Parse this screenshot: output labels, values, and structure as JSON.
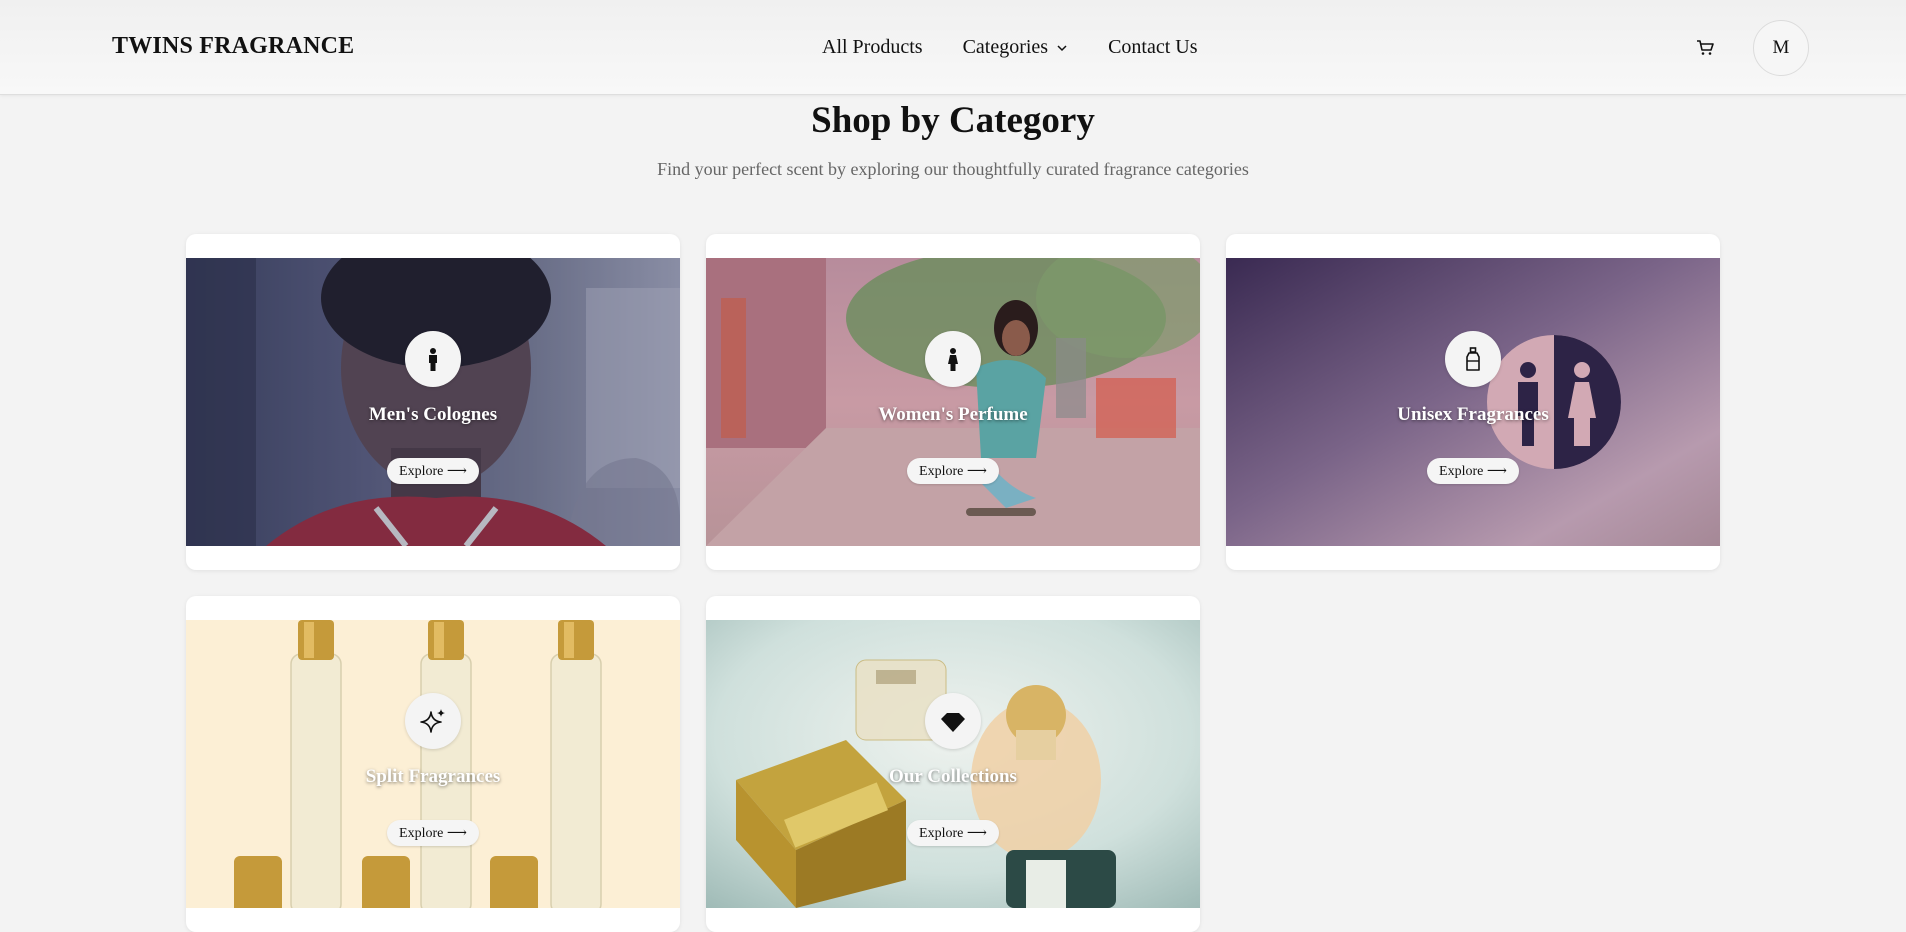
{
  "nav": {
    "brand": "TWINS FRAGRANCE",
    "links": [
      "All Products",
      "Categories",
      "Contact Us"
    ],
    "avatar_initial": "M"
  },
  "section": {
    "title": "Shop by Category",
    "subtitle": "Find your perfect scent by exploring our thoughtfully curated fragrance categories"
  },
  "categories": [
    {
      "title": "Men's Colognes",
      "button": "Explore ⟶",
      "icon": "man-icon"
    },
    {
      "title": "Women's Perfume",
      "button": "Explore ⟶",
      "icon": "woman-icon"
    },
    {
      "title": "Unisex Fragrances",
      "button": "Explore ⟶",
      "icon": "bottle-icon"
    },
    {
      "title": "Split Fragrances",
      "button": "Explore ⟶",
      "icon": "sparkles-icon"
    },
    {
      "title": "Our Collections",
      "button": "Explore ⟶",
      "icon": "gem-icon"
    }
  ],
  "colors": {
    "page_bg": "#f3f3f3",
    "card_bg": "#ffffff",
    "text": "#111111",
    "muted": "#666666"
  }
}
